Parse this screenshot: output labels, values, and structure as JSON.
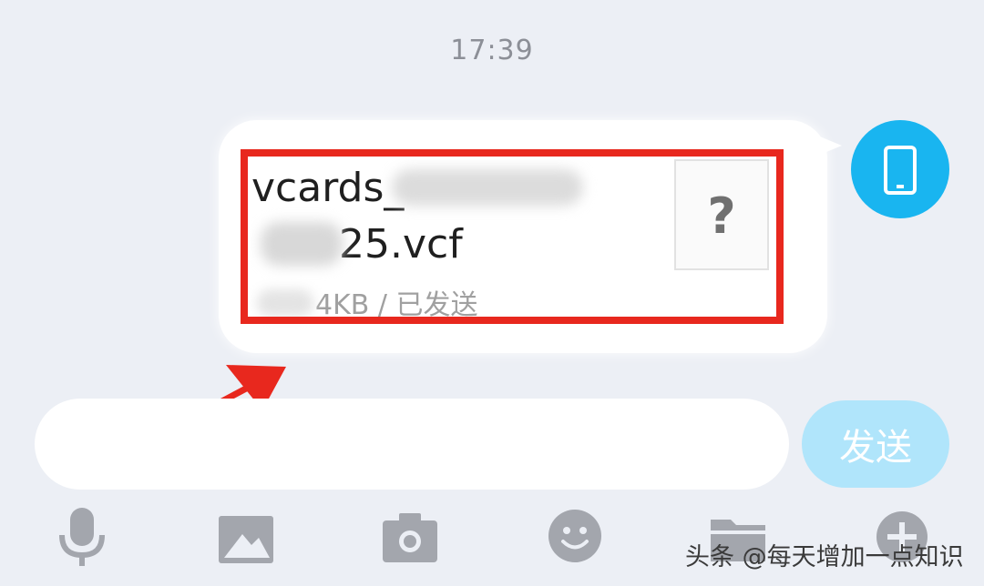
{
  "status": {
    "time": "17:39"
  },
  "message": {
    "file_name_line1": "vcards_",
    "file_name_line2": "25.vcf",
    "file_meta": "4KB / 已发送",
    "file_type_icon": "question-mark-icon",
    "file_type_glyph": "?",
    "avatar_icon": "phone-icon"
  },
  "annotation": {
    "highlight_color": "#e8281e",
    "arrow_color": "#e8281e"
  },
  "composer": {
    "input_value": "",
    "send_label": "发送",
    "send_color": "#b0e5fb"
  },
  "toolbar": {
    "items": [
      {
        "icon": "microphone-icon"
      },
      {
        "icon": "image-icon"
      },
      {
        "icon": "camera-icon"
      },
      {
        "icon": "emoji-icon"
      },
      {
        "icon": "folder-icon"
      },
      {
        "icon": "plus-icon"
      }
    ]
  },
  "watermark": {
    "text": "头条 @每天增加一点知识"
  },
  "theme": {
    "accent": "#19b5f0",
    "background": "#eceff5",
    "icon_gray": "#a3a6ad"
  }
}
